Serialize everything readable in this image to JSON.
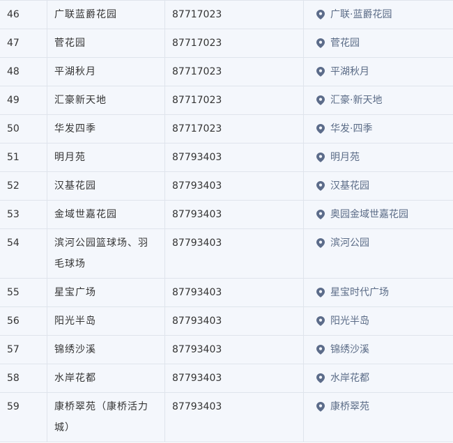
{
  "colors": {
    "row_bg": "#f4f7fc",
    "border": "#dfe4ec",
    "pin": "#5c6c8a",
    "location_text": "#5a6b86"
  },
  "rows": [
    {
      "no": "46",
      "name": "广联蓝爵花园",
      "tel": "87717023",
      "location": "广联·蓝爵花园",
      "icon": "map-pin-icon"
    },
    {
      "no": "47",
      "name": "菅花园",
      "tel": "87717023",
      "location": "菅花园",
      "icon": "map-pin-icon"
    },
    {
      "no": "48",
      "name": "平湖秋月",
      "tel": "87717023",
      "location": "平湖秋月",
      "icon": "map-pin-icon"
    },
    {
      "no": "49",
      "name": "汇豪新天地",
      "tel": "87717023",
      "location": "汇豪·新天地",
      "icon": "map-pin-icon"
    },
    {
      "no": "50",
      "name": "华发四季",
      "tel": "87717023",
      "location": "华发·四季",
      "icon": "map-pin-icon"
    },
    {
      "no": "51",
      "name": "明月苑",
      "tel": "87793403",
      "location": "明月苑",
      "icon": "map-pin-icon"
    },
    {
      "no": "52",
      "name": "汉基花园",
      "tel": "87793403",
      "location": "汉基花园",
      "icon": "map-pin-icon"
    },
    {
      "no": "53",
      "name": "金域世嘉花园",
      "tel": "87793403",
      "location": "奥园金域世嘉花园",
      "icon": "map-pin-icon"
    },
    {
      "no": "54",
      "name": "滨河公园篮球场、羽毛球场",
      "tel": "87793403",
      "location": "滨河公园",
      "icon": "map-pin-icon"
    },
    {
      "no": "55",
      "name": "星宝广场",
      "tel": "87793403",
      "location": "星宝时代广场",
      "icon": "map-pin-icon"
    },
    {
      "no": "56",
      "name": "阳光半岛",
      "tel": "87793403",
      "location": "阳光半岛",
      "icon": "map-pin-icon"
    },
    {
      "no": "57",
      "name": "锦绣沙溪",
      "tel": "87793403",
      "location": "锦绣沙溪",
      "icon": "map-pin-icon"
    },
    {
      "no": "58",
      "name": "水岸花都",
      "tel": "87793403",
      "location": "水岸花都",
      "icon": "map-pin-icon"
    },
    {
      "no": "59",
      "name": "康桥翠苑（康桥活力城）",
      "tel": "87793403",
      "location": "康桥翠苑",
      "icon": "map-pin-icon"
    }
  ]
}
